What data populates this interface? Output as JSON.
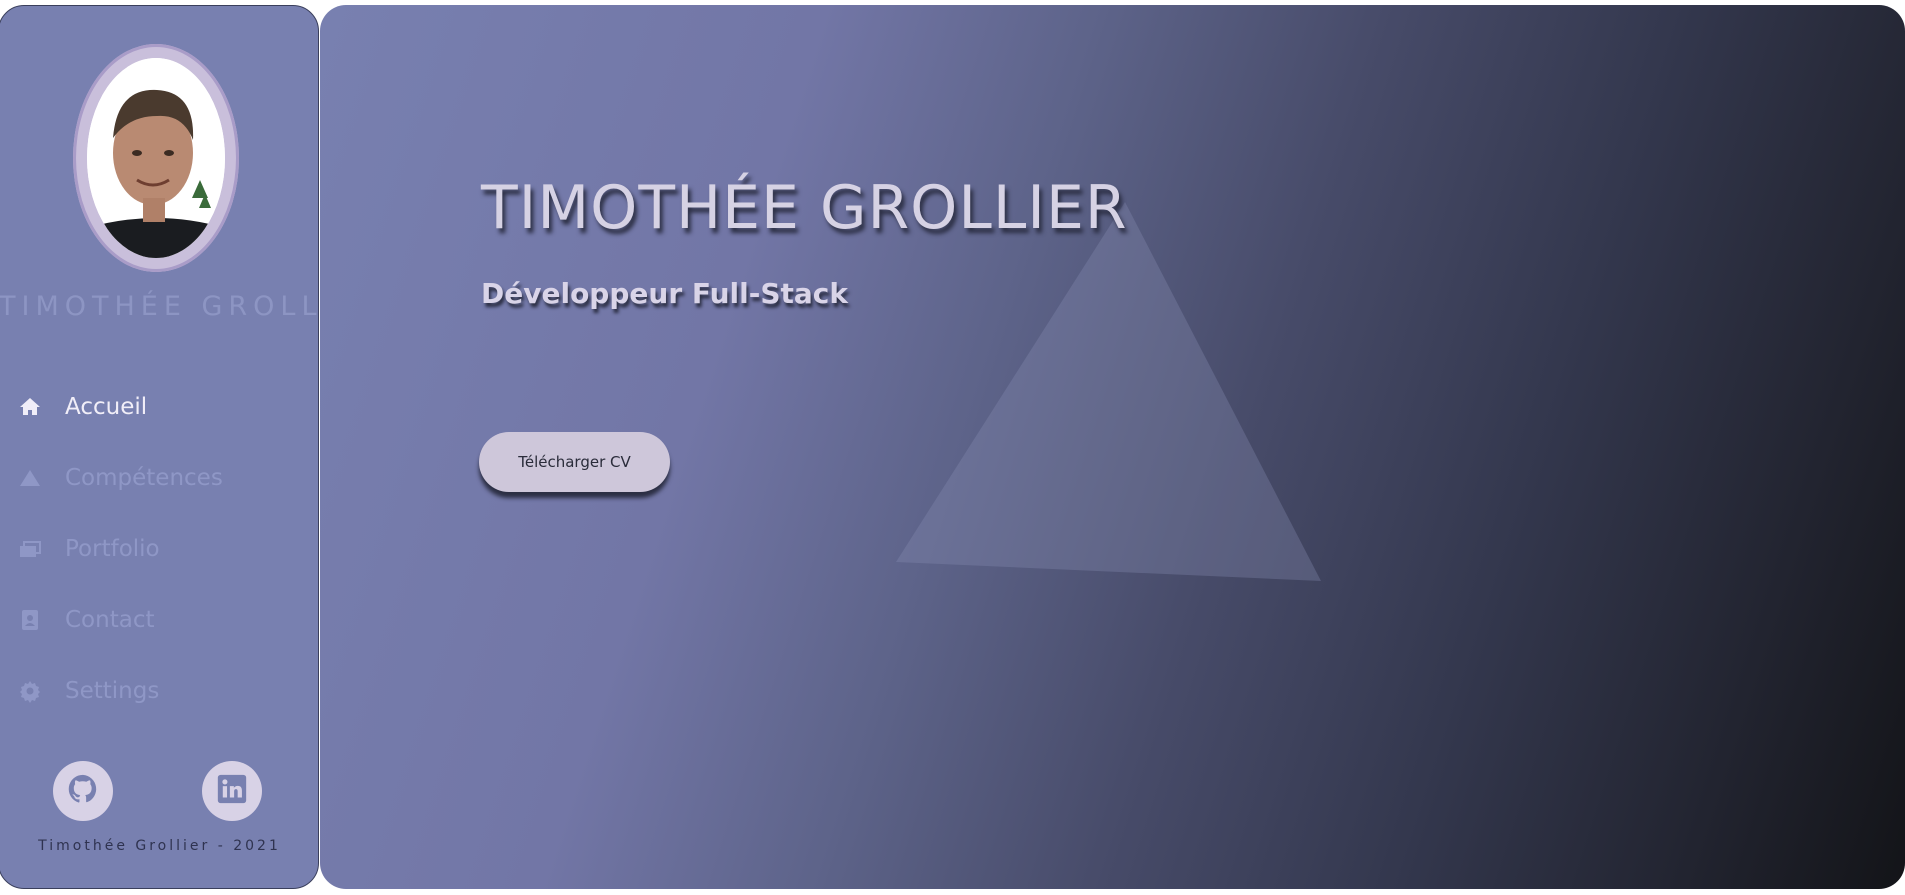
{
  "sidebar": {
    "name": "TIMOTHÉE GROLLIER",
    "nav": [
      {
        "label": "Accueil",
        "icon": "home-icon",
        "active": true
      },
      {
        "label": "Compétences",
        "icon": "triangle-icon",
        "active": false
      },
      {
        "label": "Portfolio",
        "icon": "portfolio-icon",
        "active": false
      },
      {
        "label": "Contact",
        "icon": "contact-card-icon",
        "active": false
      },
      {
        "label": "Settings",
        "icon": "gear-icon",
        "active": false
      }
    ],
    "socials": [
      {
        "icon": "github-icon"
      },
      {
        "icon": "linkedin-icon"
      }
    ],
    "footer": "Timothée Grollier - 2021"
  },
  "hero": {
    "title": "TIMOTHÉE GROLLIER",
    "subtitle": "Développeur Full-Stack",
    "cv_button": "Télécharger CV"
  },
  "colors": {
    "sidebar_bg": "#7880b0",
    "active_text": "#f1eef8",
    "inactive_text": "#8f97c6",
    "button_bg": "#cec7da",
    "gradient_end": "#131418"
  }
}
